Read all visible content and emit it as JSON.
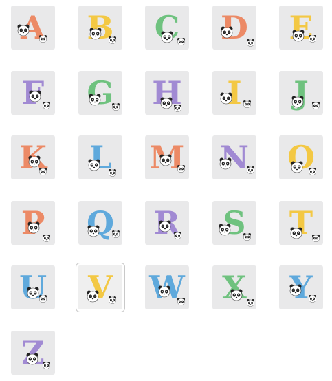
{
  "stickers": [
    {
      "letter": "A",
      "color": "#ec8a66"
    },
    {
      "letter": "B",
      "color": "#f3c844"
    },
    {
      "letter": "C",
      "color": "#6fc27f"
    },
    {
      "letter": "D",
      "color": "#ec8a66"
    },
    {
      "letter": "E",
      "color": "#f3c844"
    },
    {
      "letter": "F",
      "color": "#a18ad3"
    },
    {
      "letter": "G",
      "color": "#6fc27f"
    },
    {
      "letter": "H",
      "color": "#a18ad3"
    },
    {
      "letter": "I",
      "color": "#f3c844"
    },
    {
      "letter": "J",
      "color": "#6fc27f"
    },
    {
      "letter": "K",
      "color": "#ec8a66"
    },
    {
      "letter": "L",
      "color": "#5fa9dc"
    },
    {
      "letter": "M",
      "color": "#ec8a66"
    },
    {
      "letter": "N",
      "color": "#a18ad3"
    },
    {
      "letter": "O",
      "color": "#f3c844"
    },
    {
      "letter": "P",
      "color": "#ec8a66"
    },
    {
      "letter": "Q",
      "color": "#5fa9dc"
    },
    {
      "letter": "R",
      "color": "#a18ad3"
    },
    {
      "letter": "S",
      "color": "#6fc27f"
    },
    {
      "letter": "T",
      "color": "#f3c844"
    },
    {
      "letter": "U",
      "color": "#5fa9dc"
    },
    {
      "letter": "V",
      "color": "#f3c844"
    },
    {
      "letter": "W",
      "color": "#5fa9dc"
    },
    {
      "letter": "X",
      "color": "#6fc27f"
    },
    {
      "letter": "Y",
      "color": "#5fa9dc"
    },
    {
      "letter": "Z",
      "color": "#a18ad3"
    }
  ],
  "selected_letter": "V",
  "icon": "panda-icon"
}
